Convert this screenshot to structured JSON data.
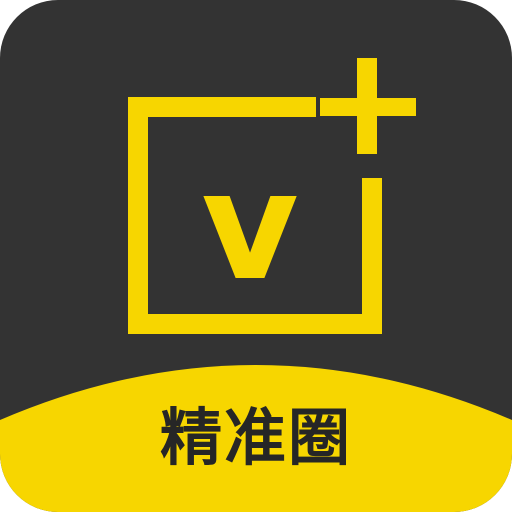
{
  "app_icon": {
    "logo_letter": "v",
    "app_name": "精准圈",
    "icon_name": "v-plus-logo-icon"
  },
  "colors": {
    "background": "#333333",
    "accent": "#f7d600"
  }
}
